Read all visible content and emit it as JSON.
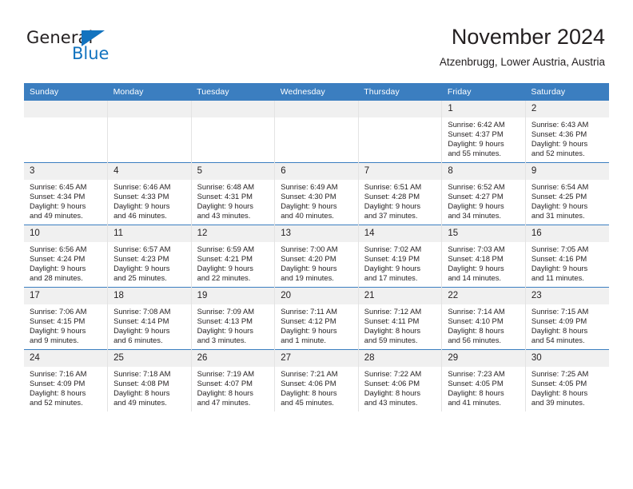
{
  "brand": {
    "name_part1": "General",
    "name_part2": "Blue",
    "triangle_color": "#1273bf"
  },
  "header": {
    "title": "November 2024",
    "subtitle": "Atzenbrugg, Lower Austria, Austria"
  },
  "theme": {
    "header_blue": "#3b7ec0",
    "daynum_gray": "#f0f0f0",
    "text": "#231f20"
  },
  "weekdays": [
    "Sunday",
    "Monday",
    "Tuesday",
    "Wednesday",
    "Thursday",
    "Friday",
    "Saturday"
  ],
  "labels": {
    "sunrise_prefix": "Sunrise: ",
    "sunset_prefix": "Sunset: ",
    "daylight_prefix": "Daylight: "
  },
  "weeks": [
    [
      {
        "empty": true
      },
      {
        "empty": true
      },
      {
        "empty": true
      },
      {
        "empty": true
      },
      {
        "empty": true
      },
      {
        "day": "1",
        "sunrise": "Sunrise: 6:42 AM",
        "sunset": "Sunset: 4:37 PM",
        "daylight1": "Daylight: 9 hours",
        "daylight2": "and 55 minutes."
      },
      {
        "day": "2",
        "sunrise": "Sunrise: 6:43 AM",
        "sunset": "Sunset: 4:36 PM",
        "daylight1": "Daylight: 9 hours",
        "daylight2": "and 52 minutes."
      }
    ],
    [
      {
        "day": "3",
        "sunrise": "Sunrise: 6:45 AM",
        "sunset": "Sunset: 4:34 PM",
        "daylight1": "Daylight: 9 hours",
        "daylight2": "and 49 minutes."
      },
      {
        "day": "4",
        "sunrise": "Sunrise: 6:46 AM",
        "sunset": "Sunset: 4:33 PM",
        "daylight1": "Daylight: 9 hours",
        "daylight2": "and 46 minutes."
      },
      {
        "day": "5",
        "sunrise": "Sunrise: 6:48 AM",
        "sunset": "Sunset: 4:31 PM",
        "daylight1": "Daylight: 9 hours",
        "daylight2": "and 43 minutes."
      },
      {
        "day": "6",
        "sunrise": "Sunrise: 6:49 AM",
        "sunset": "Sunset: 4:30 PM",
        "daylight1": "Daylight: 9 hours",
        "daylight2": "and 40 minutes."
      },
      {
        "day": "7",
        "sunrise": "Sunrise: 6:51 AM",
        "sunset": "Sunset: 4:28 PM",
        "daylight1": "Daylight: 9 hours",
        "daylight2": "and 37 minutes."
      },
      {
        "day": "8",
        "sunrise": "Sunrise: 6:52 AM",
        "sunset": "Sunset: 4:27 PM",
        "daylight1": "Daylight: 9 hours",
        "daylight2": "and 34 minutes."
      },
      {
        "day": "9",
        "sunrise": "Sunrise: 6:54 AM",
        "sunset": "Sunset: 4:25 PM",
        "daylight1": "Daylight: 9 hours",
        "daylight2": "and 31 minutes."
      }
    ],
    [
      {
        "day": "10",
        "sunrise": "Sunrise: 6:56 AM",
        "sunset": "Sunset: 4:24 PM",
        "daylight1": "Daylight: 9 hours",
        "daylight2": "and 28 minutes."
      },
      {
        "day": "11",
        "sunrise": "Sunrise: 6:57 AM",
        "sunset": "Sunset: 4:23 PM",
        "daylight1": "Daylight: 9 hours",
        "daylight2": "and 25 minutes."
      },
      {
        "day": "12",
        "sunrise": "Sunrise: 6:59 AM",
        "sunset": "Sunset: 4:21 PM",
        "daylight1": "Daylight: 9 hours",
        "daylight2": "and 22 minutes."
      },
      {
        "day": "13",
        "sunrise": "Sunrise: 7:00 AM",
        "sunset": "Sunset: 4:20 PM",
        "daylight1": "Daylight: 9 hours",
        "daylight2": "and 19 minutes."
      },
      {
        "day": "14",
        "sunrise": "Sunrise: 7:02 AM",
        "sunset": "Sunset: 4:19 PM",
        "daylight1": "Daylight: 9 hours",
        "daylight2": "and 17 minutes."
      },
      {
        "day": "15",
        "sunrise": "Sunrise: 7:03 AM",
        "sunset": "Sunset: 4:18 PM",
        "daylight1": "Daylight: 9 hours",
        "daylight2": "and 14 minutes."
      },
      {
        "day": "16",
        "sunrise": "Sunrise: 7:05 AM",
        "sunset": "Sunset: 4:16 PM",
        "daylight1": "Daylight: 9 hours",
        "daylight2": "and 11 minutes."
      }
    ],
    [
      {
        "day": "17",
        "sunrise": "Sunrise: 7:06 AM",
        "sunset": "Sunset: 4:15 PM",
        "daylight1": "Daylight: 9 hours",
        "daylight2": "and 9 minutes."
      },
      {
        "day": "18",
        "sunrise": "Sunrise: 7:08 AM",
        "sunset": "Sunset: 4:14 PM",
        "daylight1": "Daylight: 9 hours",
        "daylight2": "and 6 minutes."
      },
      {
        "day": "19",
        "sunrise": "Sunrise: 7:09 AM",
        "sunset": "Sunset: 4:13 PM",
        "daylight1": "Daylight: 9 hours",
        "daylight2": "and 3 minutes."
      },
      {
        "day": "20",
        "sunrise": "Sunrise: 7:11 AM",
        "sunset": "Sunset: 4:12 PM",
        "daylight1": "Daylight: 9 hours",
        "daylight2": "and 1 minute."
      },
      {
        "day": "21",
        "sunrise": "Sunrise: 7:12 AM",
        "sunset": "Sunset: 4:11 PM",
        "daylight1": "Daylight: 8 hours",
        "daylight2": "and 59 minutes."
      },
      {
        "day": "22",
        "sunrise": "Sunrise: 7:14 AM",
        "sunset": "Sunset: 4:10 PM",
        "daylight1": "Daylight: 8 hours",
        "daylight2": "and 56 minutes."
      },
      {
        "day": "23",
        "sunrise": "Sunrise: 7:15 AM",
        "sunset": "Sunset: 4:09 PM",
        "daylight1": "Daylight: 8 hours",
        "daylight2": "and 54 minutes."
      }
    ],
    [
      {
        "day": "24",
        "sunrise": "Sunrise: 7:16 AM",
        "sunset": "Sunset: 4:09 PM",
        "daylight1": "Daylight: 8 hours",
        "daylight2": "and 52 minutes."
      },
      {
        "day": "25",
        "sunrise": "Sunrise: 7:18 AM",
        "sunset": "Sunset: 4:08 PM",
        "daylight1": "Daylight: 8 hours",
        "daylight2": "and 49 minutes."
      },
      {
        "day": "26",
        "sunrise": "Sunrise: 7:19 AM",
        "sunset": "Sunset: 4:07 PM",
        "daylight1": "Daylight: 8 hours",
        "daylight2": "and 47 minutes."
      },
      {
        "day": "27",
        "sunrise": "Sunrise: 7:21 AM",
        "sunset": "Sunset: 4:06 PM",
        "daylight1": "Daylight: 8 hours",
        "daylight2": "and 45 minutes."
      },
      {
        "day": "28",
        "sunrise": "Sunrise: 7:22 AM",
        "sunset": "Sunset: 4:06 PM",
        "daylight1": "Daylight: 8 hours",
        "daylight2": "and 43 minutes."
      },
      {
        "day": "29",
        "sunrise": "Sunrise: 7:23 AM",
        "sunset": "Sunset: 4:05 PM",
        "daylight1": "Daylight: 8 hours",
        "daylight2": "and 41 minutes."
      },
      {
        "day": "30",
        "sunrise": "Sunrise: 7:25 AM",
        "sunset": "Sunset: 4:05 PM",
        "daylight1": "Daylight: 8 hours",
        "daylight2": "and 39 minutes."
      }
    ]
  ]
}
